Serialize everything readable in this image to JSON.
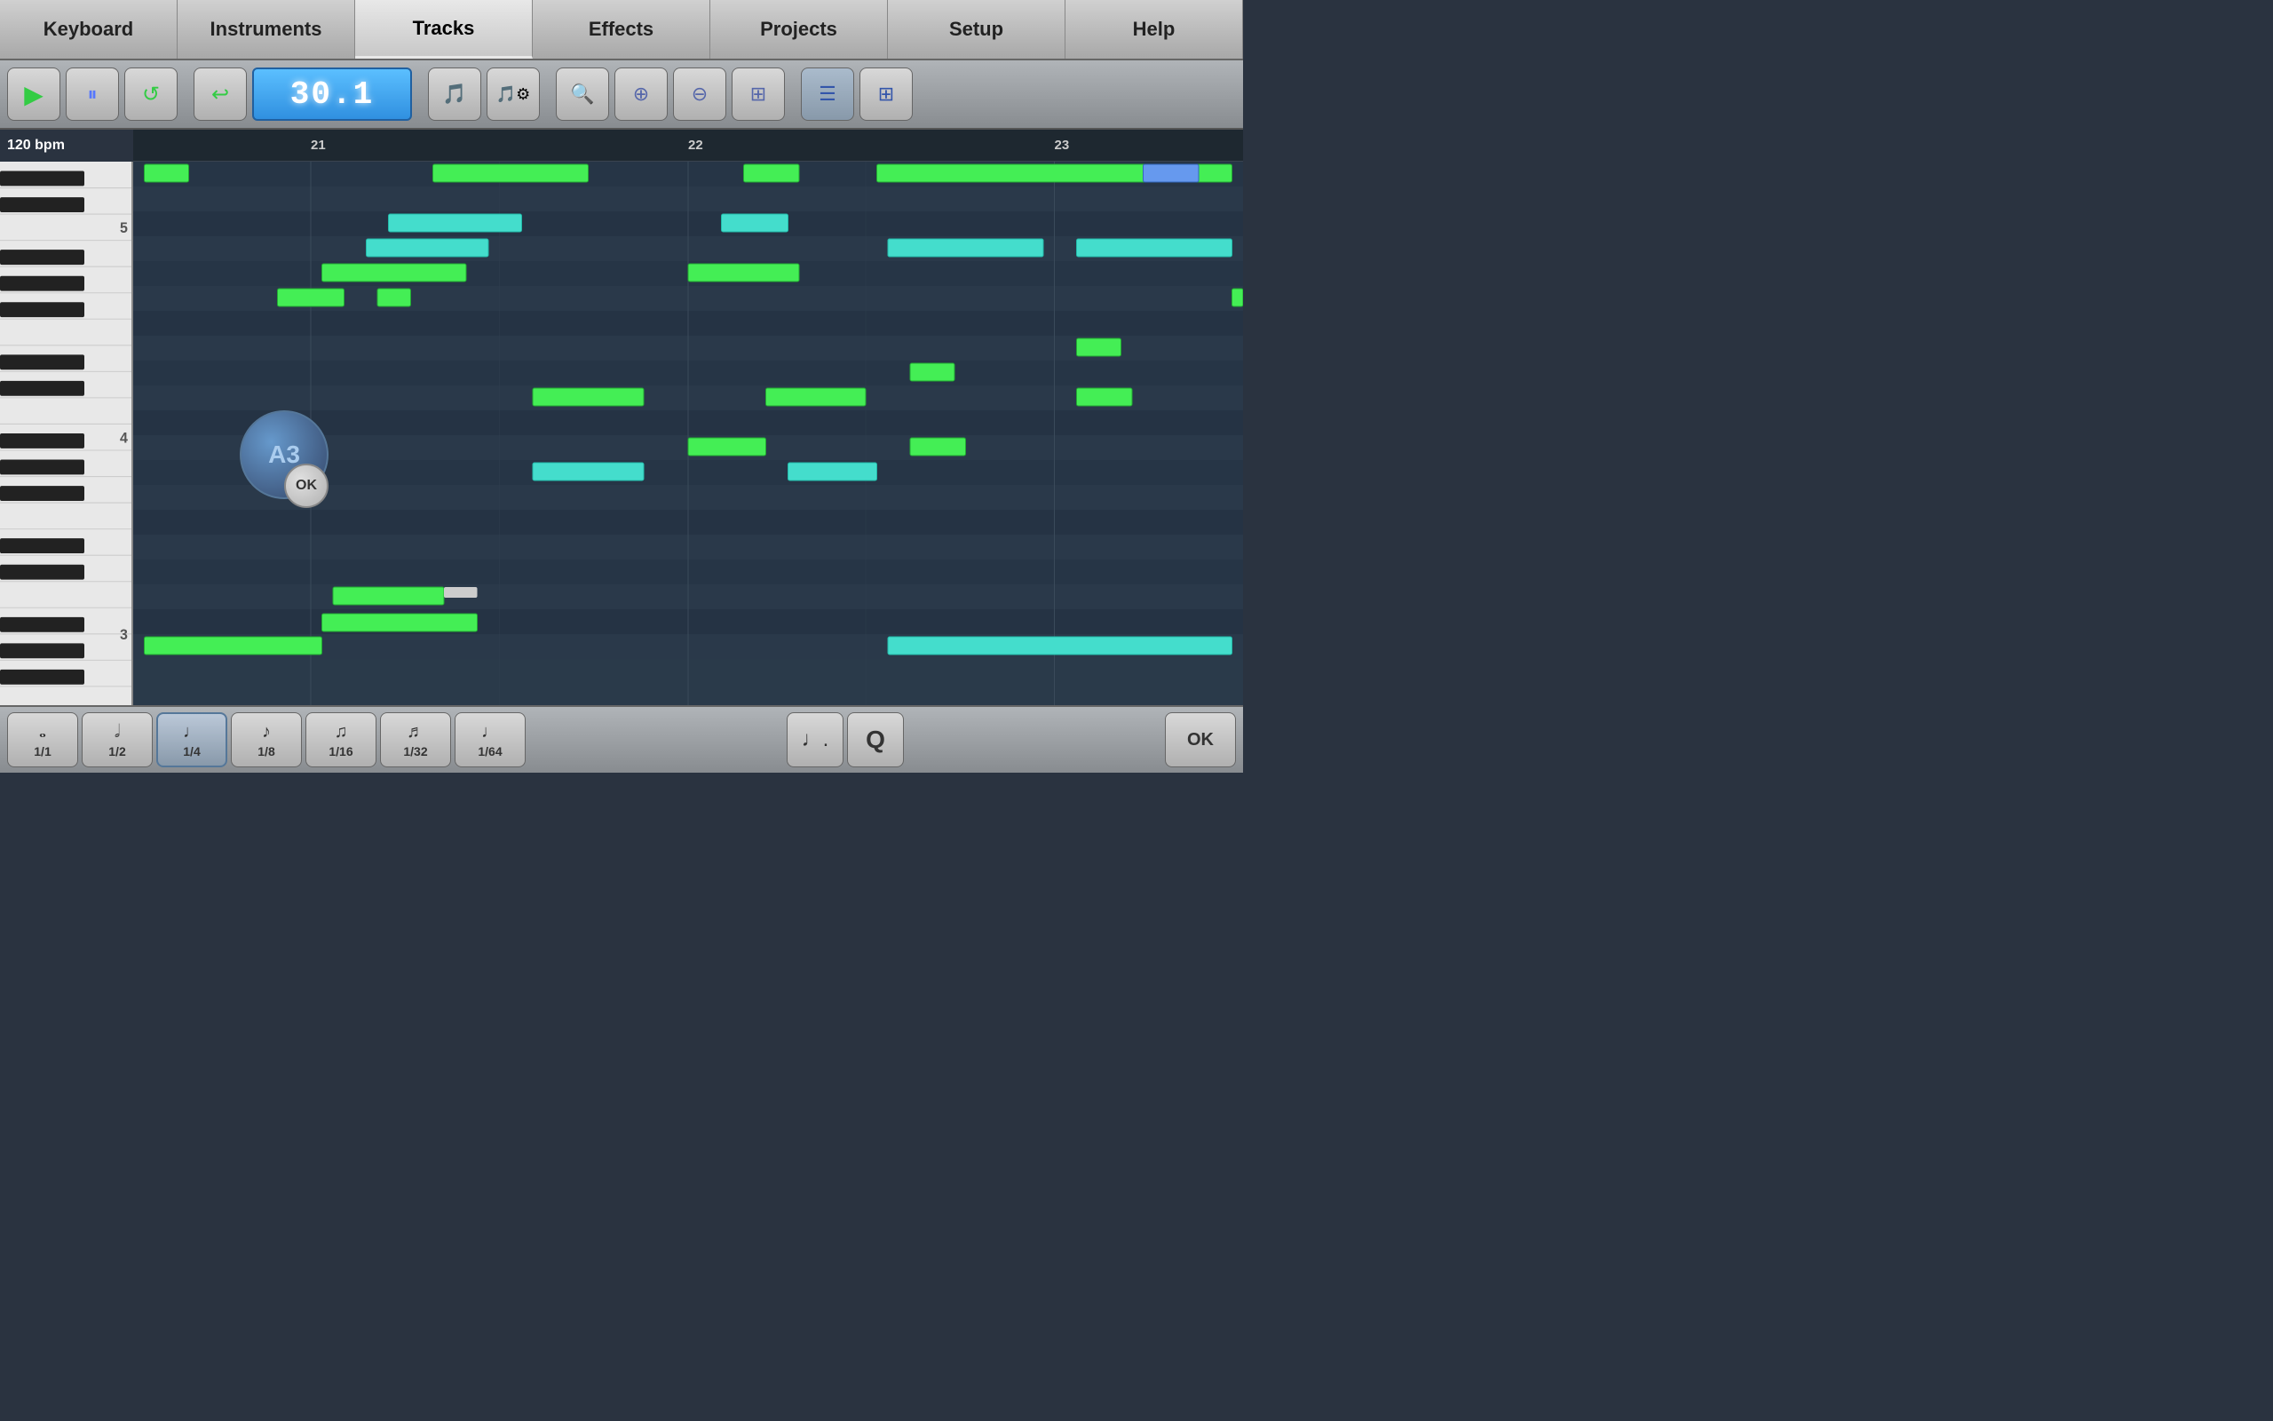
{
  "nav": {
    "tabs": [
      {
        "id": "keyboard",
        "label": "Keyboard",
        "active": false
      },
      {
        "id": "instruments",
        "label": "Instruments",
        "active": false
      },
      {
        "id": "tracks",
        "label": "Tracks",
        "active": true
      },
      {
        "id": "effects",
        "label": "Effects",
        "active": false
      },
      {
        "id": "projects",
        "label": "Projects",
        "active": false
      },
      {
        "id": "setup",
        "label": "Setup",
        "active": false
      },
      {
        "id": "help",
        "label": "Help",
        "active": false
      }
    ]
  },
  "toolbar": {
    "play_label": "▶",
    "pause_label": "⏸",
    "loop_label": "↺",
    "undo_label": "↩",
    "display_value": "30.1",
    "metronome1": "🔔",
    "metronome2": "🔔⚙",
    "zoom_in": "🔍+",
    "zoom_out": "🔍-",
    "zoom_fit": "⊞",
    "view_list": "≡",
    "view_grid": "⊞"
  },
  "main": {
    "bpm": "120 bpm",
    "markers": [
      {
        "label": "21",
        "left_pct": 16
      },
      {
        "label": "22",
        "left_pct": 50
      },
      {
        "label": "23",
        "left_pct": 83
      }
    ],
    "octave_labels": [
      "5",
      "4",
      "3"
    ],
    "popup": {
      "note": "A3",
      "ok": "OK"
    }
  },
  "bottom": {
    "durations": [
      {
        "symbol": "𝅝",
        "fraction": "1/1",
        "active": false
      },
      {
        "symbol": "𝅗𝅥",
        "fraction": "1/2",
        "active": false
      },
      {
        "symbol": "♩",
        "fraction": "1/4",
        "active": true
      },
      {
        "symbol": "♪",
        "fraction": "1/8",
        "active": false
      },
      {
        "symbol": "♫",
        "fraction": "1/16",
        "active": false
      },
      {
        "symbol": "♬",
        "fraction": "1/32",
        "active": false
      },
      {
        "symbol": "♩",
        "fraction": "1/64",
        "active": false
      }
    ],
    "dotted_note": "♩.",
    "quantize": "Q",
    "ok": "OK"
  }
}
